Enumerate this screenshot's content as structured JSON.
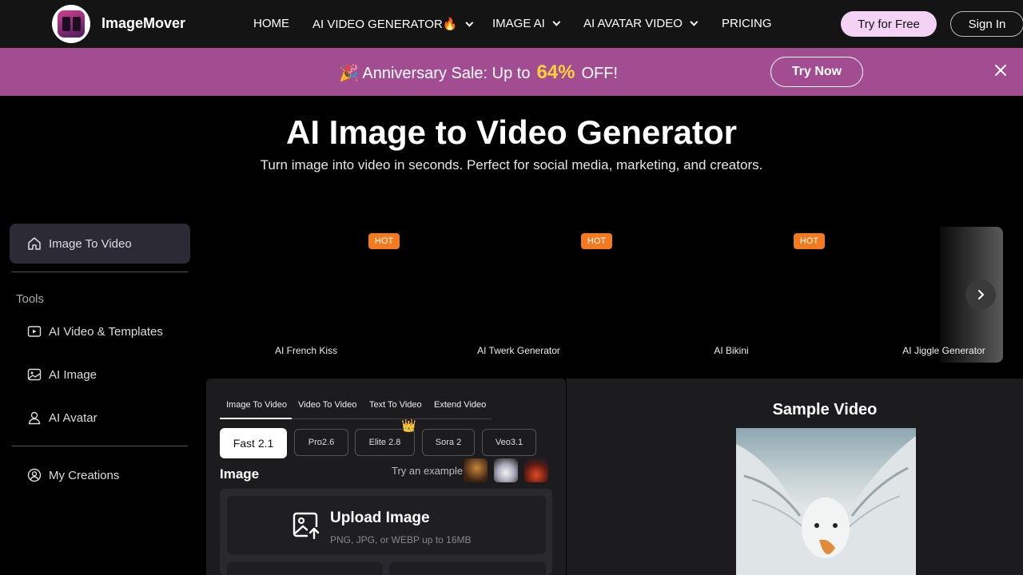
{
  "nav": {
    "brand": "ImageMover",
    "items": [
      {
        "label": "HOME",
        "dropdown": false
      },
      {
        "label": "AI VIDEO GENERATOR🔥",
        "dropdown": true
      },
      {
        "label": "IMAGE AI",
        "dropdown": true
      },
      {
        "label": "AI AVATAR VIDEO",
        "dropdown": true
      },
      {
        "label": "PRICING",
        "dropdown": false
      }
    ],
    "try_free": "Try for Free",
    "sign_in": "Sign In"
  },
  "banner": {
    "prefix": "🎉 Anniversary Sale: Up to",
    "percent": "64%",
    "suffix": "OFF!",
    "cta": "Try Now",
    "bg_color": "#a24d92",
    "accent_color": "#ffd23a"
  },
  "hero": {
    "title": "AI Image to Video Generator",
    "subtitle": "Turn image into video in seconds. Perfect for social media, marketing, and creators."
  },
  "sidebar": {
    "active_item": {
      "label": "Image To Video",
      "icon": "home-icon"
    },
    "tools_heading": "Tools",
    "items": [
      {
        "label": "AI Video & Templates",
        "icon": "video-icon"
      },
      {
        "label": "AI Image",
        "icon": "image-icon"
      },
      {
        "label": "AI Avatar",
        "icon": "user-icon"
      }
    ],
    "my_creations": {
      "label": "My Creations",
      "icon": "user-circle-icon"
    }
  },
  "templates": [
    {
      "label": "AI French Kiss",
      "badge": "HOT"
    },
    {
      "label": "AI Twerk Generator",
      "badge": "HOT"
    },
    {
      "label": "AI Bikini",
      "badge": "HOT"
    },
    {
      "label": "AI Jiggle Generator",
      "badge": ""
    }
  ],
  "generator": {
    "tabs": [
      "Image To Video",
      "Video To Video",
      "Text To Video",
      "Extend Video"
    ],
    "active_tab": "Image To Video",
    "models": [
      "Fast 2.1",
      "Pro2.6",
      "Elite 2.8",
      "Sora 2",
      "Veo3.1"
    ],
    "active_model": "Fast 2.1",
    "crown_icon": "👑",
    "image_label": "Image",
    "try_example": "Try an example",
    "upload_title": "Upload Image",
    "upload_sub": "PNG, JPG, or WEBP up to 16MB"
  },
  "sample": {
    "title": "Sample Video"
  }
}
